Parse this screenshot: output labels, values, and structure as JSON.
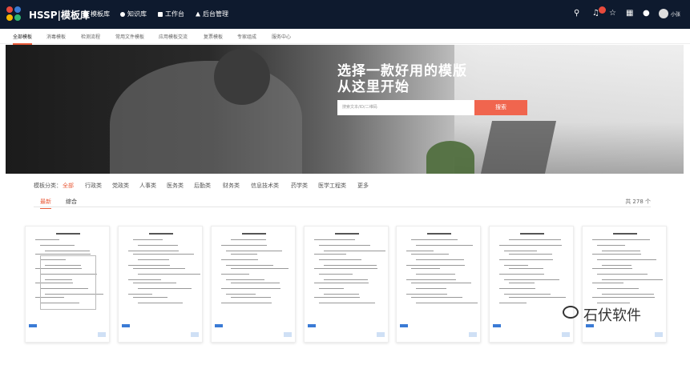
{
  "topbar": {
    "brand": "HSSP|模板库",
    "nav": [
      {
        "label": "模板库",
        "icon": "grid-icon"
      },
      {
        "label": "知识库",
        "icon": "book-icon"
      },
      {
        "label": "工作台",
        "icon": "home-icon"
      },
      {
        "label": "后台管理",
        "icon": "chart-icon"
      }
    ],
    "notif_badge": "1",
    "username": "小张"
  },
  "tabs": [
    "全部模板",
    "消毒模板",
    "检测流程",
    "常用文件模板",
    "应用模板交流",
    "复票模板",
    "专家组成",
    "服务中心"
  ],
  "banner": {
    "title_line1": "选择一款好用的模版",
    "title_line2": "从这里开始",
    "search_placeholder": "搜索文本/ID/二维码",
    "search_button": "搜索"
  },
  "categories": {
    "label": "模板分类：",
    "items": [
      "全部",
      "行政类",
      "党政类",
      "人事类",
      "医务类",
      "后勤类",
      "财务类",
      "信息技术类",
      "药学类",
      "医学工程类",
      "更多"
    ]
  },
  "sort": {
    "tabs": [
      "最新",
      "综合"
    ],
    "count": "共 278 个"
  },
  "watermark": "石伏软件",
  "colors": {
    "accent": "#e95c3b",
    "topbar": "#0e1a2e",
    "search_btn": "#f0654e"
  }
}
